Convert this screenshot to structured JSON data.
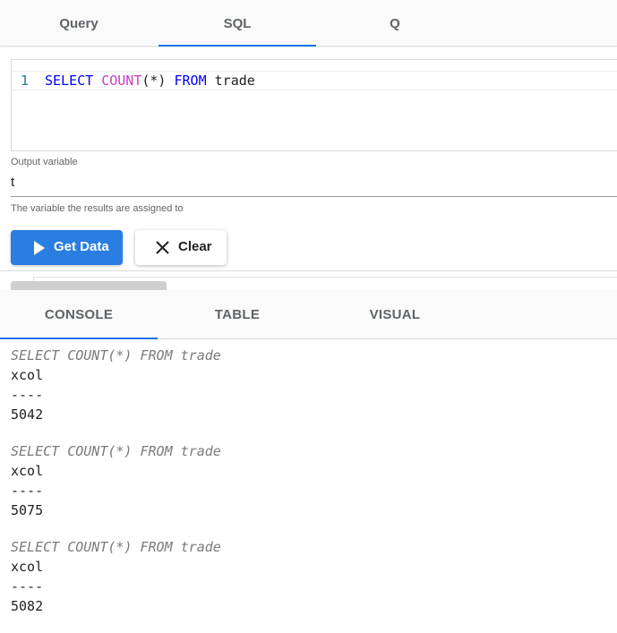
{
  "top_tabs": [
    {
      "label": "Query",
      "active": false
    },
    {
      "label": "SQL",
      "active": true
    },
    {
      "label": "Q",
      "active": false
    }
  ],
  "editor": {
    "line_number": "1",
    "tokens": {
      "select": "SELECT",
      "count": "COUNT",
      "args": "(*)",
      "from": "FROM",
      "table": "trade"
    }
  },
  "output_variable": {
    "label": "Output variable",
    "value": "t",
    "hint": "The variable the results are assigned to"
  },
  "buttons": {
    "get_data": "Get Data",
    "clear": "Clear"
  },
  "bottom_tabs": [
    {
      "label": "CONSOLE",
      "active": true
    },
    {
      "label": "TABLE",
      "active": false
    },
    {
      "label": "VISUAL",
      "active": false
    }
  ],
  "console": [
    {
      "query": "SELECT COUNT(*) FROM trade",
      "column": "xcol",
      "divider": "----",
      "value": "5042"
    },
    {
      "query": "SELECT COUNT(*) FROM trade",
      "column": "xcol",
      "divider": "----",
      "value": "5075"
    },
    {
      "query": "SELECT COUNT(*) FROM trade",
      "column": "xcol",
      "divider": "----",
      "value": "5082"
    }
  ],
  "colors": {
    "accent": "#1a73e8",
    "primary_button": "#2a7de1",
    "keyword": "#0000ff",
    "function": "#c53dbf"
  }
}
